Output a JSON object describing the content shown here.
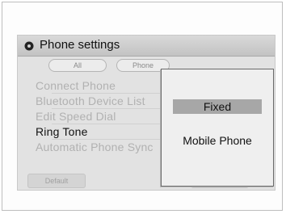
{
  "screen": {
    "title": "Phone settings",
    "title_icon": "gear-icon"
  },
  "tabs": [
    {
      "label": "All"
    },
    {
      "label": "Phone"
    }
  ],
  "menu": [
    {
      "label": "Connect Phone",
      "active": false
    },
    {
      "label": "Bluetooth Device List",
      "active": false
    },
    {
      "label": "Edit Speed Dial",
      "active": false
    },
    {
      "label": "Ring Tone",
      "active": true
    },
    {
      "label": "Automatic Phone Sync",
      "active": false
    }
  ],
  "bottom_buttons": [
    {
      "label": "Default"
    },
    {
      "label": ""
    }
  ],
  "popup": {
    "options": [
      {
        "label": "Fixed",
        "selected": true
      },
      {
        "label": "Mobile Phone",
        "selected": false
      }
    ]
  },
  "colors": {
    "selected_bg": "#a7a7a7",
    "inactive_text": "#b1b1b1",
    "active_text": "#111111"
  }
}
